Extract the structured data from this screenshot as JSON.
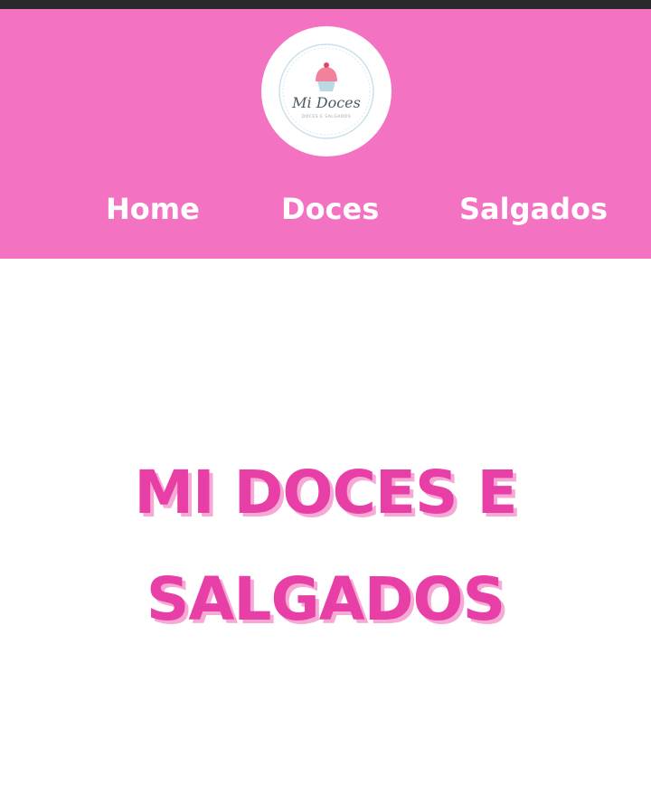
{
  "header": {
    "logo": {
      "brand": "Mi Doces",
      "tagline": "DOCES E SALGADOS"
    },
    "nav": [
      "Home",
      "Doces",
      "Salgados"
    ]
  },
  "hero": {
    "line1": "MI DOCES E",
    "line2": "SALGADOS"
  },
  "colors": {
    "header_bg": "#f472c2",
    "hero_text": "#e83fa7",
    "hero_shadow": "#f6a9d4",
    "cupcake_top": "#f2829c",
    "cupcake_base": "#bcd9e3"
  }
}
